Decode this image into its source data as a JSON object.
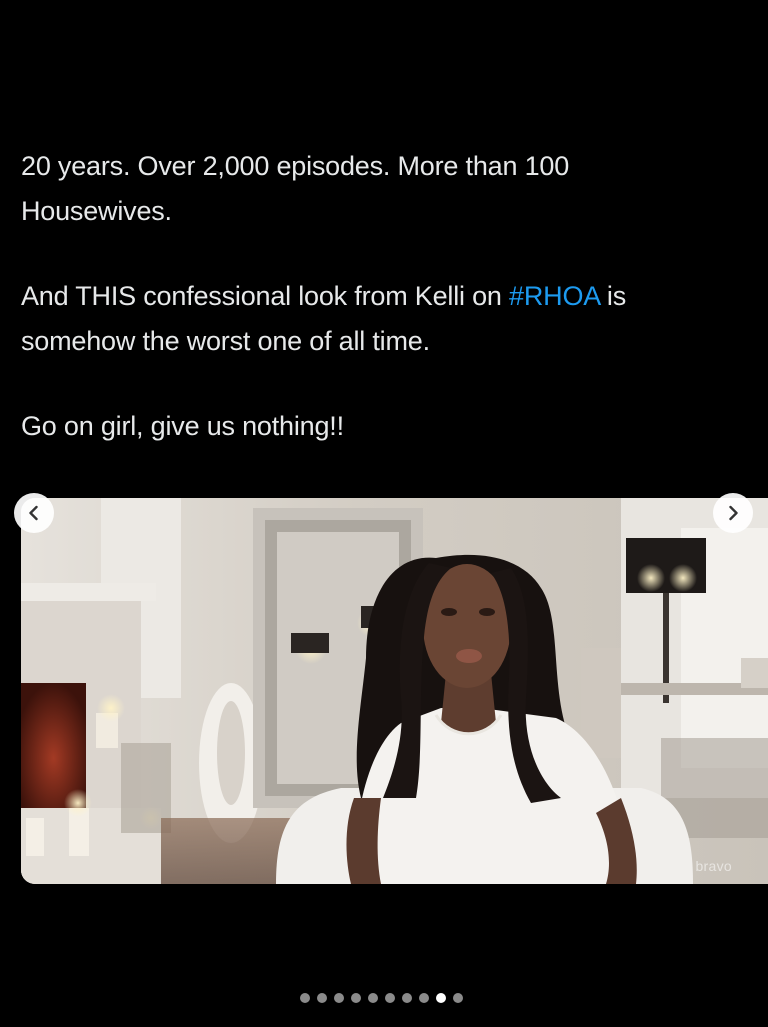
{
  "post": {
    "paragraph1_line1": "20 years. Over 2,000 episodes. More than 100",
    "paragraph1_line2": "Housewives.",
    "paragraph2_before_tag": "And THIS confessional look from Kelli on ",
    "paragraph2_hashtag": "#RHOA",
    "paragraph2_after_tag": " is",
    "paragraph2_line2": "somehow the worst one of all time.",
    "paragraph3": "Go on girl, give us nothing!!"
  },
  "media": {
    "watermark": "bravo",
    "prev_icon": "chevron-left-icon",
    "next_icon": "chevron-right-icon"
  },
  "carousel": {
    "total_slides": 10,
    "active_index": 8
  },
  "colors": {
    "background": "#000000",
    "text": "#e7e9ea",
    "hashtag": "#1d9bf0",
    "dot_active": "#ffffff",
    "dot_inactive": "#8b8b8b"
  }
}
